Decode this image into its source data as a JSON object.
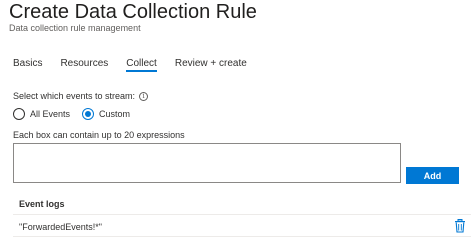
{
  "header": {
    "title": "Create Data Collection Rule",
    "subtitle": "Data collection rule management"
  },
  "tabs": [
    {
      "label": "Basics",
      "active": false
    },
    {
      "label": "Resources",
      "active": false
    },
    {
      "label": "Collect",
      "active": true
    },
    {
      "label": "Review + create",
      "active": false
    }
  ],
  "events": {
    "prompt": "Select which events to stream:",
    "info_icon": "info-icon",
    "options": [
      {
        "label": "All Events",
        "selected": false
      },
      {
        "label": "Custom",
        "selected": true
      }
    ]
  },
  "expressions": {
    "label": "Each box can contain up to 20 expressions",
    "value": "",
    "add_label": "Add"
  },
  "event_logs": {
    "header": "Event logs",
    "rows": [
      {
        "value": "\"ForwardedEvents!*\"",
        "action_icon": "trash-icon"
      }
    ]
  },
  "colors": {
    "accent": "#0078d4",
    "text": "#323130",
    "delete_icon": "#0078d4"
  }
}
